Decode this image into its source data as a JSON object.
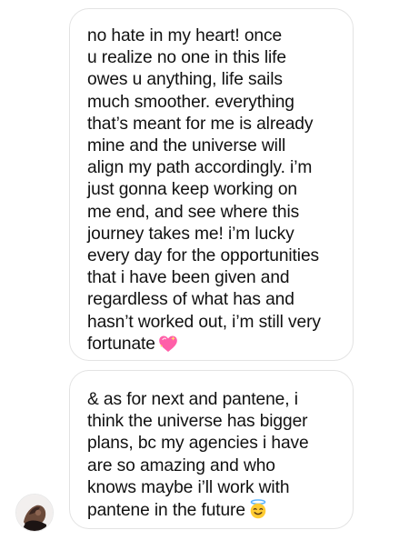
{
  "thread": {
    "messages": [
      {
        "text": "no hate in my heart! once\nu realize no one in this life\nowes u anything, life sails\nmuch smoother. everything\nthat’s meant for me is already\nmine and the universe will\nalign my path accordingly. i’m\njust gonna keep working on\nme end, and see where this\njourney takes me! i’m lucky\nevery day for the opportunities\nthat i have been given and\nregardless of what has and\nhasn’t worked out, i’m still very\nfortunate",
        "emoji_icon": "heart-with-sparkles-icon"
      },
      {
        "text": "& as for next and pantene, i\nthink the universe has bigger\nplans, bc my agencies i have\nare so amazing and who\nknows maybe i’ll work with\npantene in the future",
        "emoji_icon": "smiling-face-with-halo-icon"
      }
    ]
  },
  "colors": {
    "bubble_border": "#e3e3e3",
    "text": "#111111",
    "heart_pink": "#ff5fa8",
    "halo_face_yellow": "#ffcc33"
  }
}
